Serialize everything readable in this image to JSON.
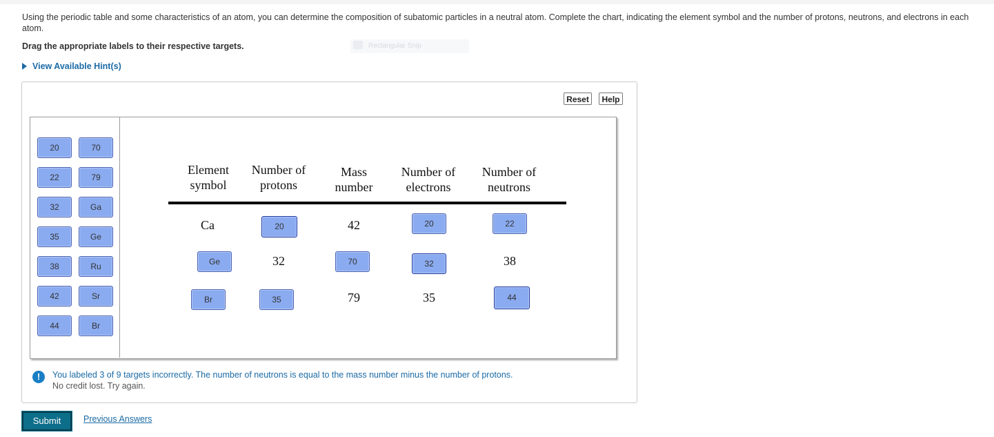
{
  "intro_text": "Using the periodic table and some characteristics of an atom, you can determine the composition of subatomic particles in a neutral atom. Complete the chart, indicating the element symbol and the number of protons, neutrons, and electrons in each atom.",
  "instruction": "Drag the appropriate labels to their respective targets.",
  "hint_link": "View Available Hint(s)",
  "snip_overlay": "Rectangular Snip",
  "buttons": {
    "reset": "Reset",
    "help": "Help"
  },
  "label_bank": [
    "20",
    "70",
    "22",
    "79",
    "32",
    "Ga",
    "35",
    "Ge",
    "38",
    "Ru",
    "42",
    "Sr",
    "44",
    "Br"
  ],
  "table": {
    "headers": [
      [
        "Element",
        "symbol"
      ],
      [
        "Number of",
        "protons"
      ],
      [
        "Mass",
        "number"
      ],
      [
        "Number of",
        "electrons"
      ],
      [
        "Number of",
        "neutrons"
      ]
    ],
    "rows": [
      [
        "Ca",
        "20",
        "42",
        "20",
        "22"
      ],
      [
        "Ge",
        "32",
        "70",
        "32",
        "38"
      ],
      [
        "Br",
        "35",
        "79",
        "35",
        "44"
      ]
    ]
  },
  "feedback": {
    "icon": "!",
    "line1": "You labeled 3 of 9 targets incorrectly. The number of neutrons is equal to the mass number minus the number of protons.",
    "line2": "No credit lost. Try again."
  },
  "submit": "Submit",
  "previous_answers": "Previous Answers",
  "colors": {
    "label_fill": "#8aabf0",
    "label_border": "#4a63b0",
    "link": "#1b6aa5",
    "submit_bg": "#0d6e8a"
  }
}
